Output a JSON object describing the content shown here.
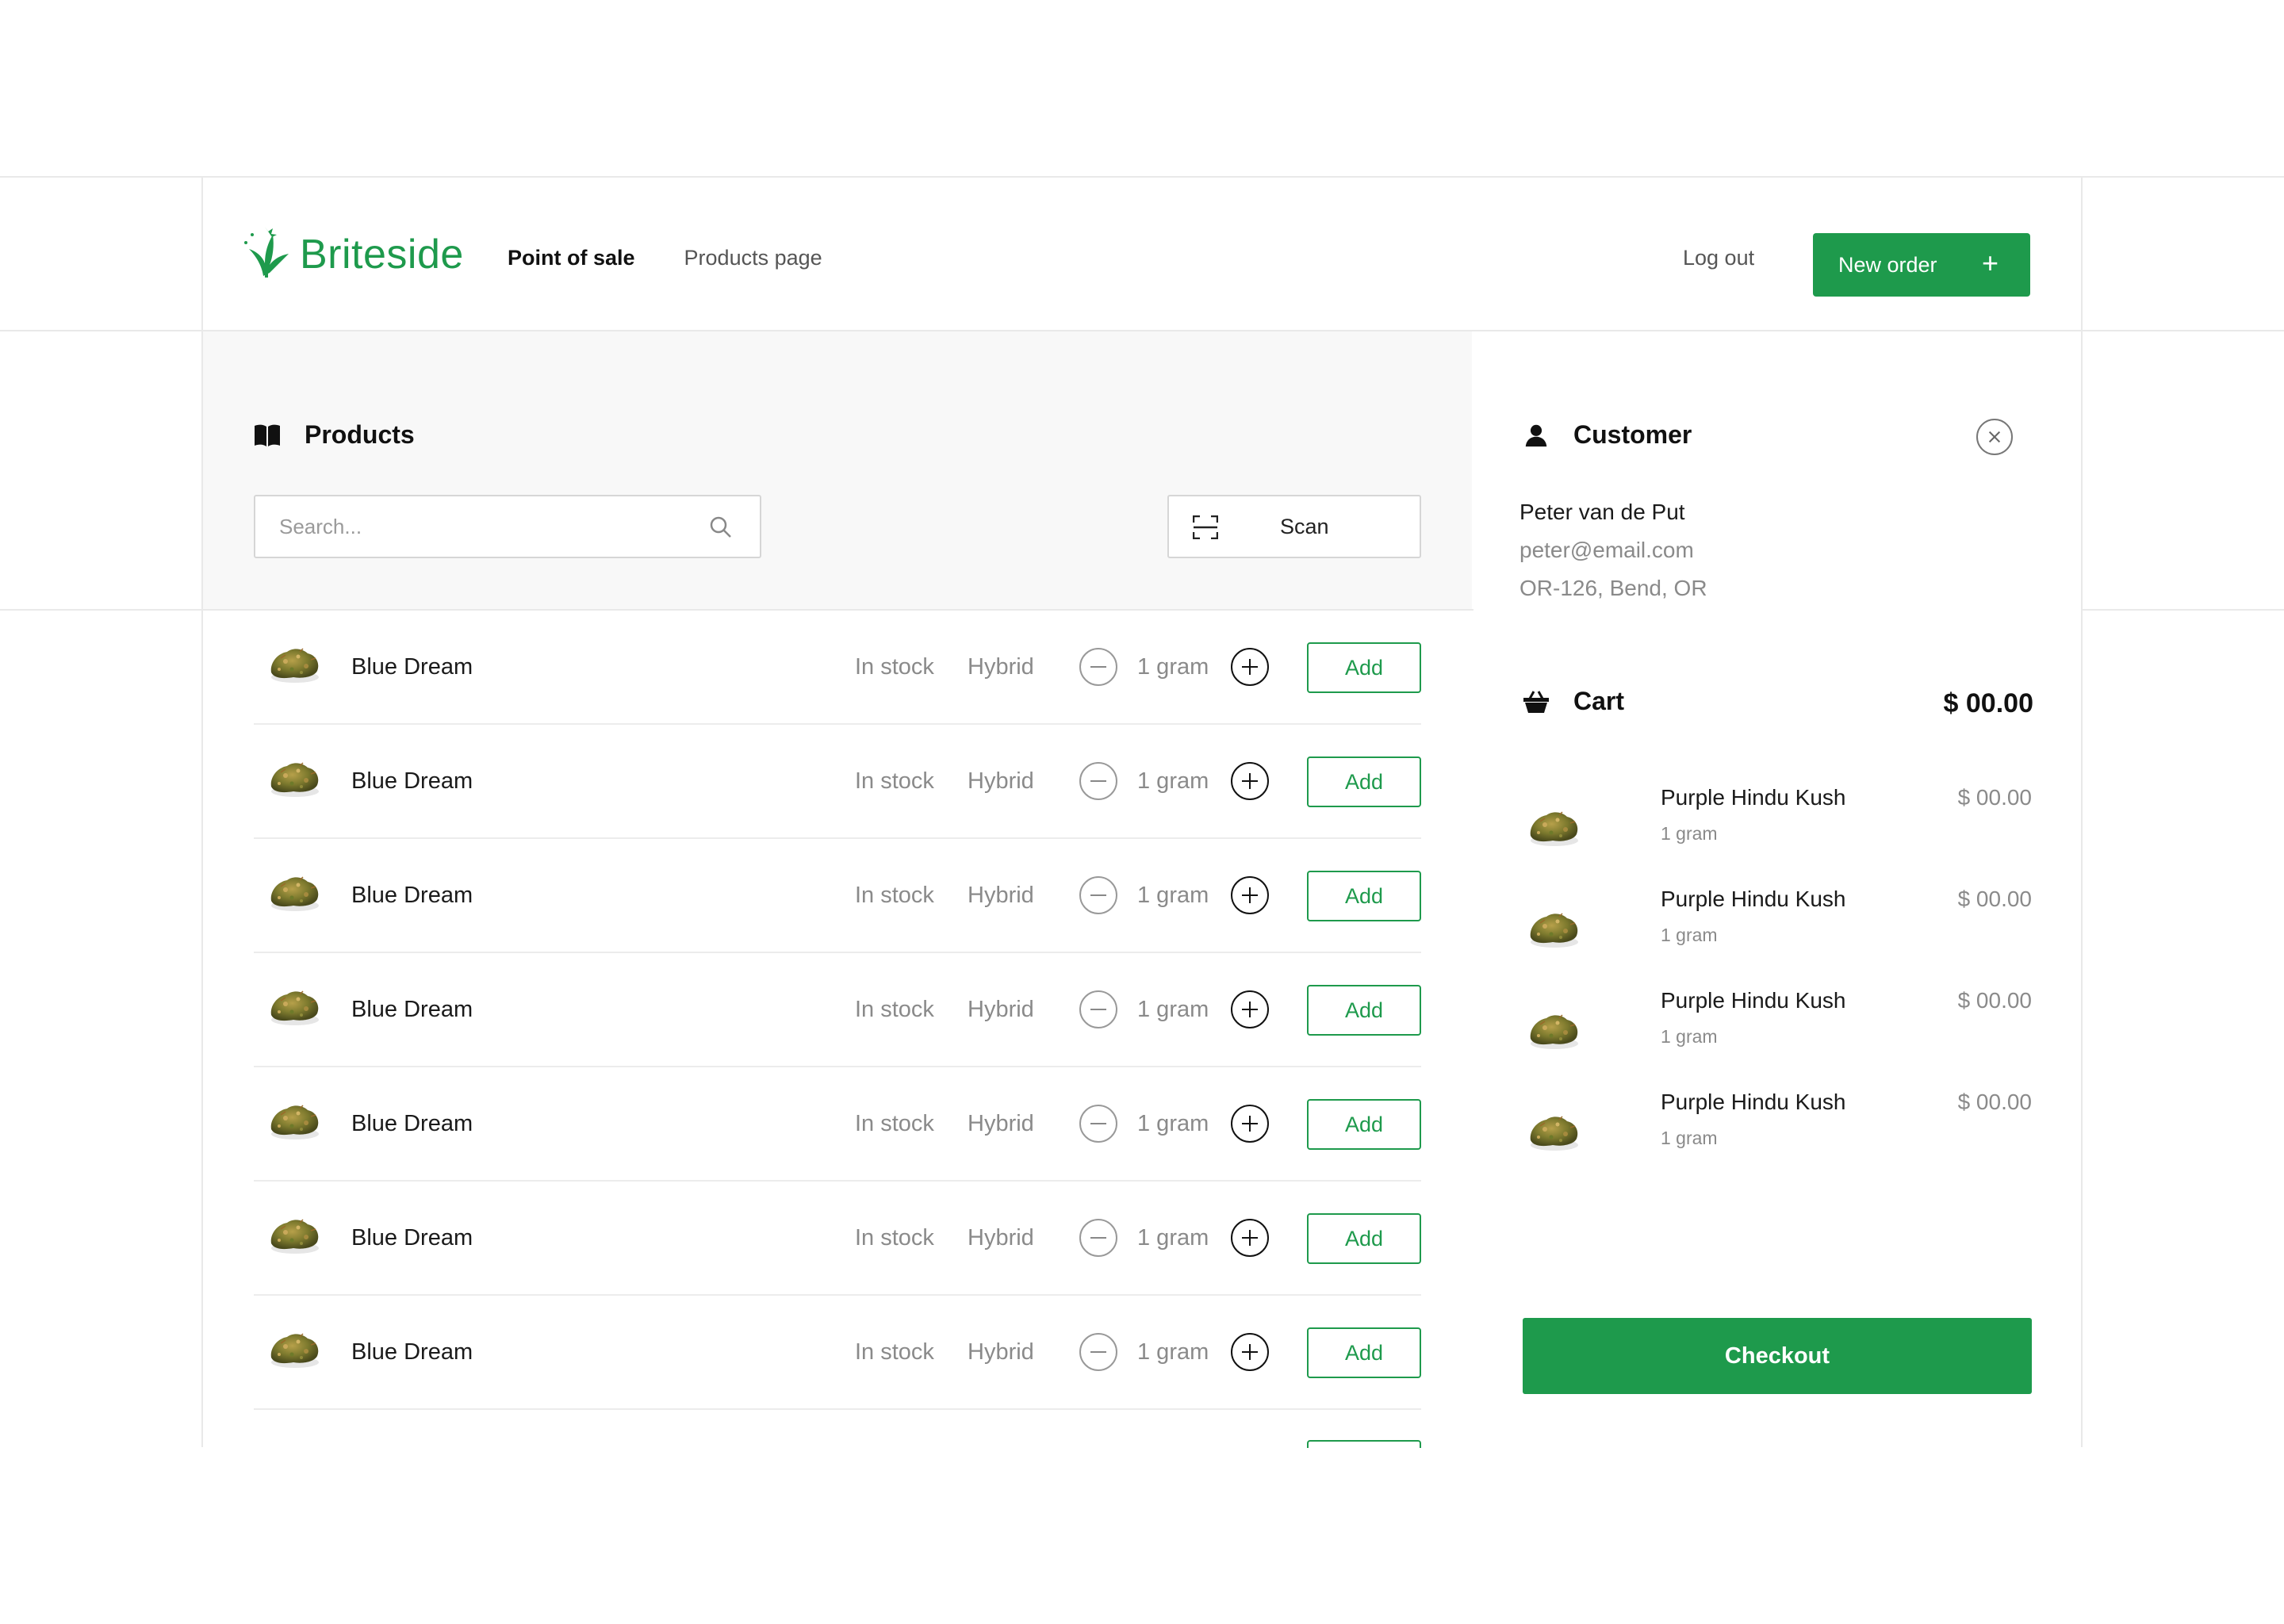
{
  "colors": {
    "brand_green": "#1e9a4c",
    "panel_gray": "#f8f8f8",
    "muted_text": "#8a8a8a",
    "divider": "#e9e9e9"
  },
  "header": {
    "logo_text": "Briteside",
    "logo_icon": "cannabis-leaf-icon",
    "nav": [
      {
        "label": "Point of sale",
        "active": true
      },
      {
        "label": "Products page",
        "active": false
      }
    ],
    "logout_label": "Log out",
    "new_order_label": "New order",
    "new_order_icon": "plus-icon"
  },
  "products": {
    "title": "Products",
    "title_icon": "open-book-icon",
    "search_placeholder": "Search...",
    "search_icon": "magnifier-icon",
    "scan_label": "Scan",
    "scan_icon": "barcode-scan-icon",
    "rows": [
      {
        "name": "Blue Dream",
        "stock": "In stock",
        "type": "Hybrid",
        "qty": "1 gram",
        "add_label": "Add"
      },
      {
        "name": "Blue Dream",
        "stock": "In stock",
        "type": "Hybrid",
        "qty": "1 gram",
        "add_label": "Add"
      },
      {
        "name": "Blue Dream",
        "stock": "In stock",
        "type": "Hybrid",
        "qty": "1 gram",
        "add_label": "Add"
      },
      {
        "name": "Blue Dream",
        "stock": "In stock",
        "type": "Hybrid",
        "qty": "1 gram",
        "add_label": "Add"
      },
      {
        "name": "Blue Dream",
        "stock": "In stock",
        "type": "Hybrid",
        "qty": "1 gram",
        "add_label": "Add"
      },
      {
        "name": "Blue Dream",
        "stock": "In stock",
        "type": "Hybrid",
        "qty": "1 gram",
        "add_label": "Add"
      },
      {
        "name": "Blue Dream",
        "stock": "In stock",
        "type": "Hybrid",
        "qty": "1 gram",
        "add_label": "Add"
      }
    ]
  },
  "customer": {
    "title": "Customer",
    "title_icon": "user-icon",
    "close_icon": "close-circle-icon",
    "name": "Peter van de Put",
    "email": "peter@email.com",
    "address": "OR-126, Bend, OR"
  },
  "cart": {
    "title": "Cart",
    "title_icon": "basket-icon",
    "total": "$ 00.00",
    "items": [
      {
        "name": "Purple Hindu Kush",
        "qty": "1 gram",
        "price": "$ 00.00"
      },
      {
        "name": "Purple Hindu Kush",
        "qty": "1 gram",
        "price": "$ 00.00"
      },
      {
        "name": "Purple Hindu Kush",
        "qty": "1 gram",
        "price": "$ 00.00"
      },
      {
        "name": "Purple Hindu Kush",
        "qty": "1 gram",
        "price": "$ 00.00"
      }
    ],
    "checkout_label": "Checkout"
  }
}
